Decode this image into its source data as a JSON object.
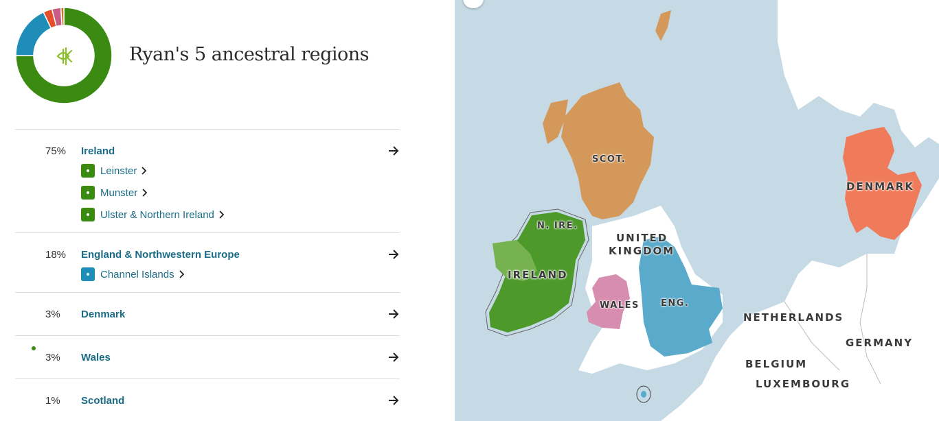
{
  "header": {
    "title": "Ryan's 5 ancestral regions",
    "logo_icon": "ancestry-leaf-icon"
  },
  "donut": {
    "segments": [
      {
        "region": "Ireland",
        "percent": 75,
        "color": "#3b8b12"
      },
      {
        "region": "England & Northwestern Europe",
        "percent": 18,
        "color": "#1e8db7"
      },
      {
        "region": "Denmark",
        "percent": 3,
        "color": "#e4502a"
      },
      {
        "region": "Wales",
        "percent": 3,
        "color": "#c75c86"
      },
      {
        "region": "Scotland",
        "percent": 1,
        "color": "#c97422"
      }
    ]
  },
  "regions": [
    {
      "percent": "75%",
      "name": "Ireland",
      "color": "#3b8b12",
      "subregions": [
        "Leinster",
        "Munster",
        "Ulster & Northern Ireland"
      ]
    },
    {
      "percent": "18%",
      "name": "England & Northwestern Europe",
      "color": "#1e8db7",
      "subregions": [
        "Channel Islands"
      ]
    },
    {
      "percent": "3%",
      "name": "Denmark",
      "color": "#e4502a",
      "subregions": []
    },
    {
      "percent": "3%",
      "name": "Wales",
      "color": "#c75c86",
      "subregions": [],
      "new_badge": true
    },
    {
      "percent": "1%",
      "name": "Scotland",
      "color": "#c97422",
      "subregions": []
    }
  ],
  "map": {
    "labels": {
      "scot": "SCOT.",
      "nire": "N. IRE.",
      "ireland": "IRELAND",
      "uk1": "UNITED",
      "uk2": "KINGDOM",
      "wales": "WALES",
      "eng": "ENG.",
      "denmark": "DENMARK",
      "netherlands": "NETHERLANDS",
      "germany": "GERMANY",
      "belgium": "BELGIUM",
      "luxembourg": "LUXEMBOURG"
    },
    "colors": {
      "water": "#c6dae5",
      "land": "#ffffff",
      "scotland": "#d4995a",
      "ireland": "#4d9a2a",
      "ireland_light": "#77b251",
      "wales": "#d78daf",
      "england": "#5aaacb",
      "denmark": "#f07b5a"
    }
  }
}
